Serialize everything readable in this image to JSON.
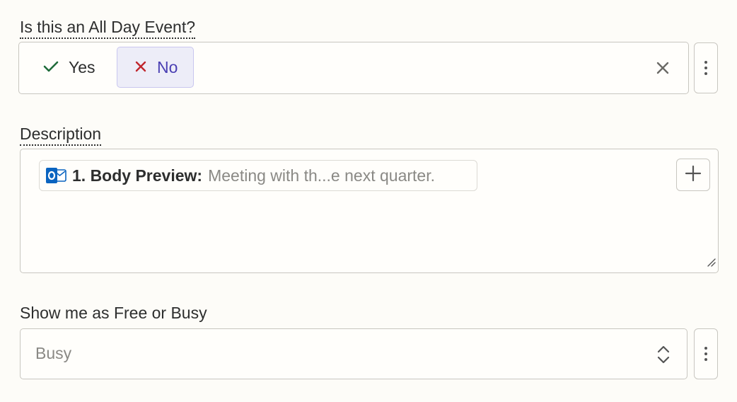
{
  "all_day": {
    "label": "Is this an All Day Event?",
    "options": [
      {
        "label": "Yes",
        "icon": "check-icon",
        "selected": false
      },
      {
        "label": "No",
        "icon": "x-icon",
        "selected": true
      }
    ],
    "clear_icon": "clear-icon",
    "more_icon": "more-vertical-icon"
  },
  "description": {
    "label": "Description",
    "token": {
      "app_icon": "outlook-icon",
      "label": "1. Body Preview:",
      "value": "Meeting with th...e next quarter."
    },
    "add_icon": "plus-icon",
    "resize_icon": "resize-handle-icon"
  },
  "show_as": {
    "label": "Show me as Free or Busy",
    "value": "Busy",
    "chevron_icon": "up-down-chevron-icon",
    "more_icon": "more-vertical-icon"
  },
  "colors": {
    "background": "#fdfcf8",
    "selected_bg": "#ededf8",
    "selected_text": "#4a3fb3",
    "check": "#1f6b3a",
    "cross": "#c0262d",
    "outlook_blue": "#0a64c0"
  }
}
